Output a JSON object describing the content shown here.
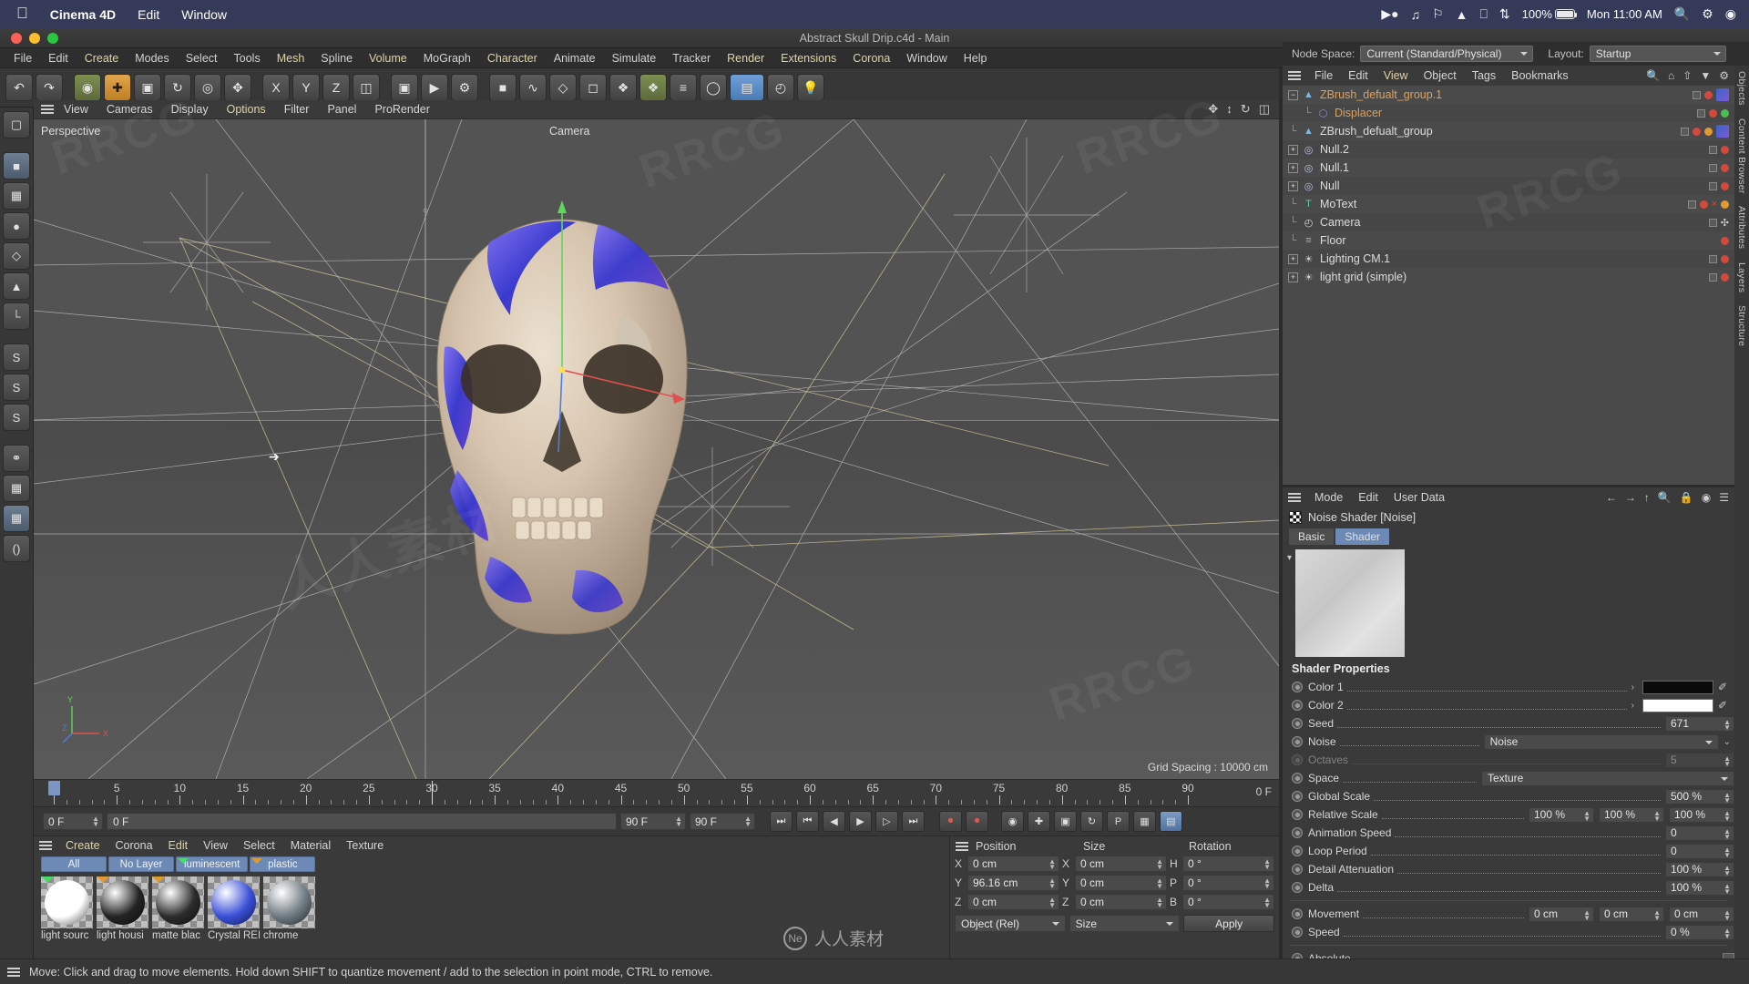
{
  "mac_menu": {
    "apple": "",
    "app": "Cinema 4D",
    "items": [
      "Edit",
      "Window"
    ],
    "status": {
      "battery_pct": "100%",
      "time": "Mon 11:00 AM"
    }
  },
  "window": {
    "title": "Abstract Skull Drip.c4d - Main"
  },
  "main_menu": [
    {
      "label": "File",
      "hl": false
    },
    {
      "label": "Edit",
      "hl": false
    },
    {
      "label": "Create",
      "hl": true
    },
    {
      "label": "Modes",
      "hl": false
    },
    {
      "label": "Select",
      "hl": false
    },
    {
      "label": "Tools",
      "hl": false
    },
    {
      "label": "Mesh",
      "hl": true
    },
    {
      "label": "Spline",
      "hl": false
    },
    {
      "label": "Volume",
      "hl": true
    },
    {
      "label": "MoGraph",
      "hl": false
    },
    {
      "label": "Character",
      "hl": true
    },
    {
      "label": "Animate",
      "hl": false
    },
    {
      "label": "Simulate",
      "hl": false
    },
    {
      "label": "Tracker",
      "hl": false
    },
    {
      "label": "Render",
      "hl": true
    },
    {
      "label": "Extensions",
      "hl": true
    },
    {
      "label": "Corona",
      "hl": true
    },
    {
      "label": "Window",
      "hl": false
    },
    {
      "label": "Help",
      "hl": false
    }
  ],
  "node_space": {
    "label": "Node Space:",
    "value": "Current (Standard/Physical)",
    "layout_label": "Layout:",
    "layout_value": "Startup"
  },
  "viewport": {
    "menu": [
      {
        "label": "View",
        "hl": false
      },
      {
        "label": "Cameras",
        "hl": false
      },
      {
        "label": "Display",
        "hl": false
      },
      {
        "label": "Options",
        "hl": true
      },
      {
        "label": "Filter",
        "hl": false
      },
      {
        "label": "Panel",
        "hl": false
      },
      {
        "label": "ProRender",
        "hl": false
      }
    ],
    "perspective_label": "Perspective",
    "camera_label": "Camera",
    "grid_spacing": "Grid Spacing : 10000 cm",
    "axis": {
      "x": "X",
      "y": "Y",
      "z": "Z"
    }
  },
  "timeline": {
    "ticks": [
      "0",
      "5",
      "10",
      "15",
      "20",
      "25",
      "30",
      "35",
      "40",
      "45",
      "50",
      "55",
      "60",
      "65",
      "70",
      "75",
      "80",
      "85",
      "90"
    ],
    "current_frame": "0 F",
    "end_frame_right": "0 F",
    "playhead_frame": "0",
    "left_field": "0 F",
    "slider_field": "0 F",
    "range_end": "90 F",
    "preview_end": "90 F"
  },
  "material_manager": {
    "menu": [
      {
        "label": "Create",
        "hl": true
      },
      {
        "label": "Corona",
        "hl": false
      },
      {
        "label": "Edit",
        "hl": true
      },
      {
        "label": "View",
        "hl": false
      },
      {
        "label": "Select",
        "hl": false
      },
      {
        "label": "Material",
        "hl": false
      },
      {
        "label": "Texture",
        "hl": false
      }
    ],
    "tabs": [
      {
        "label": "All",
        "flag": ""
      },
      {
        "label": "No Layer",
        "flag": ""
      },
      {
        "label": "luminescent",
        "flag": "#4ad96a"
      },
      {
        "label": "plastic",
        "flag": "#e09a32"
      }
    ],
    "materials": [
      {
        "name": "light sourc",
        "color": "#ffffff",
        "flag": "#4ad96a"
      },
      {
        "name": "light housi",
        "color": "#242424",
        "flag": "#e09a32"
      },
      {
        "name": "matte blac",
        "color": "#2c2c2c",
        "flag": "#e09a32"
      },
      {
        "name": "Crystal REI",
        "color": "#3a4fd8",
        "flag": ""
      },
      {
        "name": "chrome",
        "color": "#6f7a82",
        "flag": ""
      }
    ]
  },
  "coordinates": {
    "headers": [
      "Position",
      "Size",
      "Rotation"
    ],
    "rows": [
      {
        "ax1": "X",
        "v1": "0 cm",
        "ax2": "X",
        "v2": "0 cm",
        "ax3": "H",
        "v3": "0 °"
      },
      {
        "ax1": "Y",
        "v1": "96.16 cm",
        "ax2": "Y",
        "v2": "0 cm",
        "ax3": "P",
        "v3": "0 °"
      },
      {
        "ax1": "Z",
        "v1": "0 cm",
        "ax2": "Z",
        "v2": "0 cm",
        "ax3": "B",
        "v3": "0 °"
      }
    ],
    "mode_combo": "Object (Rel)",
    "size_combo": "Size",
    "apply_button": "Apply"
  },
  "object_manager": {
    "menu": [
      {
        "label": "File",
        "hl": false
      },
      {
        "label": "Edit",
        "hl": false
      },
      {
        "label": "View",
        "hl": true
      },
      {
        "label": "Object",
        "hl": false
      },
      {
        "label": "Tags",
        "hl": false
      },
      {
        "label": "Bookmarks",
        "hl": false
      }
    ],
    "objects": [
      {
        "name": "ZBrush_defualt_group.1",
        "indent": 0,
        "expand": "minus",
        "icon": "mesh-icon",
        "icon_color": "#7bb6e8",
        "orange": true,
        "tags": [
          "check",
          "red"
        ],
        "tagthumb": "#3a63c8"
      },
      {
        "name": "Displacer",
        "indent": 1,
        "expand": "none",
        "icon": "deformer-icon",
        "icon_color": "#9a8ad8",
        "orange": true,
        "tags": [
          "check",
          "red",
          "green"
        ],
        "tagthumb": ""
      },
      {
        "name": "ZBrush_defualt_group",
        "indent": 0,
        "expand": "none",
        "icon": "mesh-icon",
        "icon_color": "#7bb6e8",
        "orange": false,
        "tags": [
          "check",
          "red",
          "orange"
        ],
        "tagthumb": "#3a63c8"
      },
      {
        "name": "Null.2",
        "indent": 0,
        "expand": "plus",
        "icon": "null-icon",
        "icon_color": "#b8c4e8",
        "orange": false,
        "tags": [
          "check",
          "red"
        ],
        "tagthumb": ""
      },
      {
        "name": "Null.1",
        "indent": 0,
        "expand": "plus",
        "icon": "null-icon",
        "icon_color": "#b8c4e8",
        "orange": false,
        "tags": [
          "check",
          "red"
        ],
        "tagthumb": ""
      },
      {
        "name": "Null",
        "indent": 0,
        "expand": "plus",
        "icon": "null-icon",
        "icon_color": "#b8c4e8",
        "orange": false,
        "tags": [
          "check",
          "red"
        ],
        "tagthumb": ""
      },
      {
        "name": "MoText",
        "indent": 0,
        "expand": "none",
        "icon": "motext-icon",
        "icon_color": "#5ecb96",
        "orange": false,
        "tags": [
          "check",
          "red",
          "x",
          "orange"
        ],
        "tagthumb": ""
      },
      {
        "name": "Camera",
        "indent": 0,
        "expand": "none",
        "icon": "camera-icon",
        "icon_color": "#dcdcdc",
        "orange": false,
        "tags": [
          "check",
          "crosshair"
        ],
        "tagthumb": ""
      },
      {
        "name": "Floor",
        "indent": 0,
        "expand": "none",
        "icon": "floor-icon",
        "icon_color": "#8fb4dd",
        "orange": false,
        "tags": [
          "red"
        ],
        "tagthumb": ""
      },
      {
        "name": "Lighting CM.1",
        "indent": 0,
        "expand": "plus",
        "icon": "light-icon",
        "icon_color": "#cfcfcf",
        "orange": false,
        "tags": [
          "check",
          "red"
        ],
        "tagthumb": ""
      },
      {
        "name": "light grid (simple)",
        "indent": 0,
        "expand": "plus",
        "icon": "light-icon",
        "icon_color": "#cfcfcf",
        "orange": false,
        "tags": [
          "check",
          "red"
        ],
        "tagthumb": ""
      }
    ]
  },
  "attributes": {
    "menu": [
      {
        "label": "Mode",
        "hl": false
      },
      {
        "label": "Edit",
        "hl": false
      },
      {
        "label": "User Data",
        "hl": false
      }
    ],
    "title": "Noise Shader [Noise]",
    "tabs": [
      {
        "label": "Basic",
        "on": false
      },
      {
        "label": "Shader",
        "on": true
      }
    ],
    "section": "Shader Properties",
    "props": [
      {
        "label": "Color 1",
        "type": "color",
        "value": "#0a0a0a",
        "dim": false,
        "arrow": true,
        "eyedrop": true
      },
      {
        "label": "Color 2",
        "type": "color",
        "value": "#ffffff",
        "dim": false,
        "arrow": true,
        "eyedrop": true
      },
      {
        "label": "Seed",
        "type": "num",
        "value": "671",
        "dim": false
      },
      {
        "label": "Noise",
        "type": "drop-wide",
        "value": "Noise",
        "dim": false,
        "extra": "chevron"
      },
      {
        "label": "Octaves",
        "type": "num",
        "value": "5",
        "dim": true
      },
      {
        "label": "Space",
        "type": "drop-full",
        "value": "Texture",
        "dim": false
      },
      {
        "label": "Global Scale",
        "type": "num",
        "value": "500 %",
        "dim": false
      },
      {
        "label": "Relative Scale",
        "type": "num3",
        "value": "100 %",
        "value2": "100 %",
        "value3": "100 %",
        "dim": false
      },
      {
        "label": "Animation Speed",
        "type": "num",
        "value": "0",
        "dim": false
      },
      {
        "label": "Loop Period",
        "type": "num",
        "value": "0",
        "dim": false
      },
      {
        "label": "Detail Attenuation",
        "type": "num",
        "value": "100 %",
        "dim": false
      },
      {
        "label": "Delta",
        "type": "num",
        "value": "100 %",
        "dim": false
      },
      {
        "label": "__sep__",
        "type": "sep"
      },
      {
        "label": "Movement",
        "type": "num3",
        "value": "0 cm",
        "value2": "0 cm",
        "value3": "0 cm",
        "dim": false
      },
      {
        "label": "Speed",
        "type": "num",
        "value": "0 %",
        "dim": false
      },
      {
        "label": "__sep__",
        "type": "sep"
      },
      {
        "label": "Absolute",
        "type": "check",
        "value": "",
        "dim": false
      }
    ]
  },
  "right_tabs": [
    "Objects",
    "Content Browser",
    "Attributes",
    "Layers",
    "Structure"
  ],
  "status_bar": {
    "text": "Move: Click and drag to move elements. Hold down SHIFT to quantize movement / add to the selection in point mode, CTRL to remove."
  },
  "watermark": {
    "brand": "RRCG",
    "site": "人人素材"
  },
  "colors": {
    "accent_blue": "#6d89b5",
    "menu_highlight": "#ded3a8",
    "panel_bg": "#3a3a3a",
    "viewport_bg": "#535353"
  }
}
